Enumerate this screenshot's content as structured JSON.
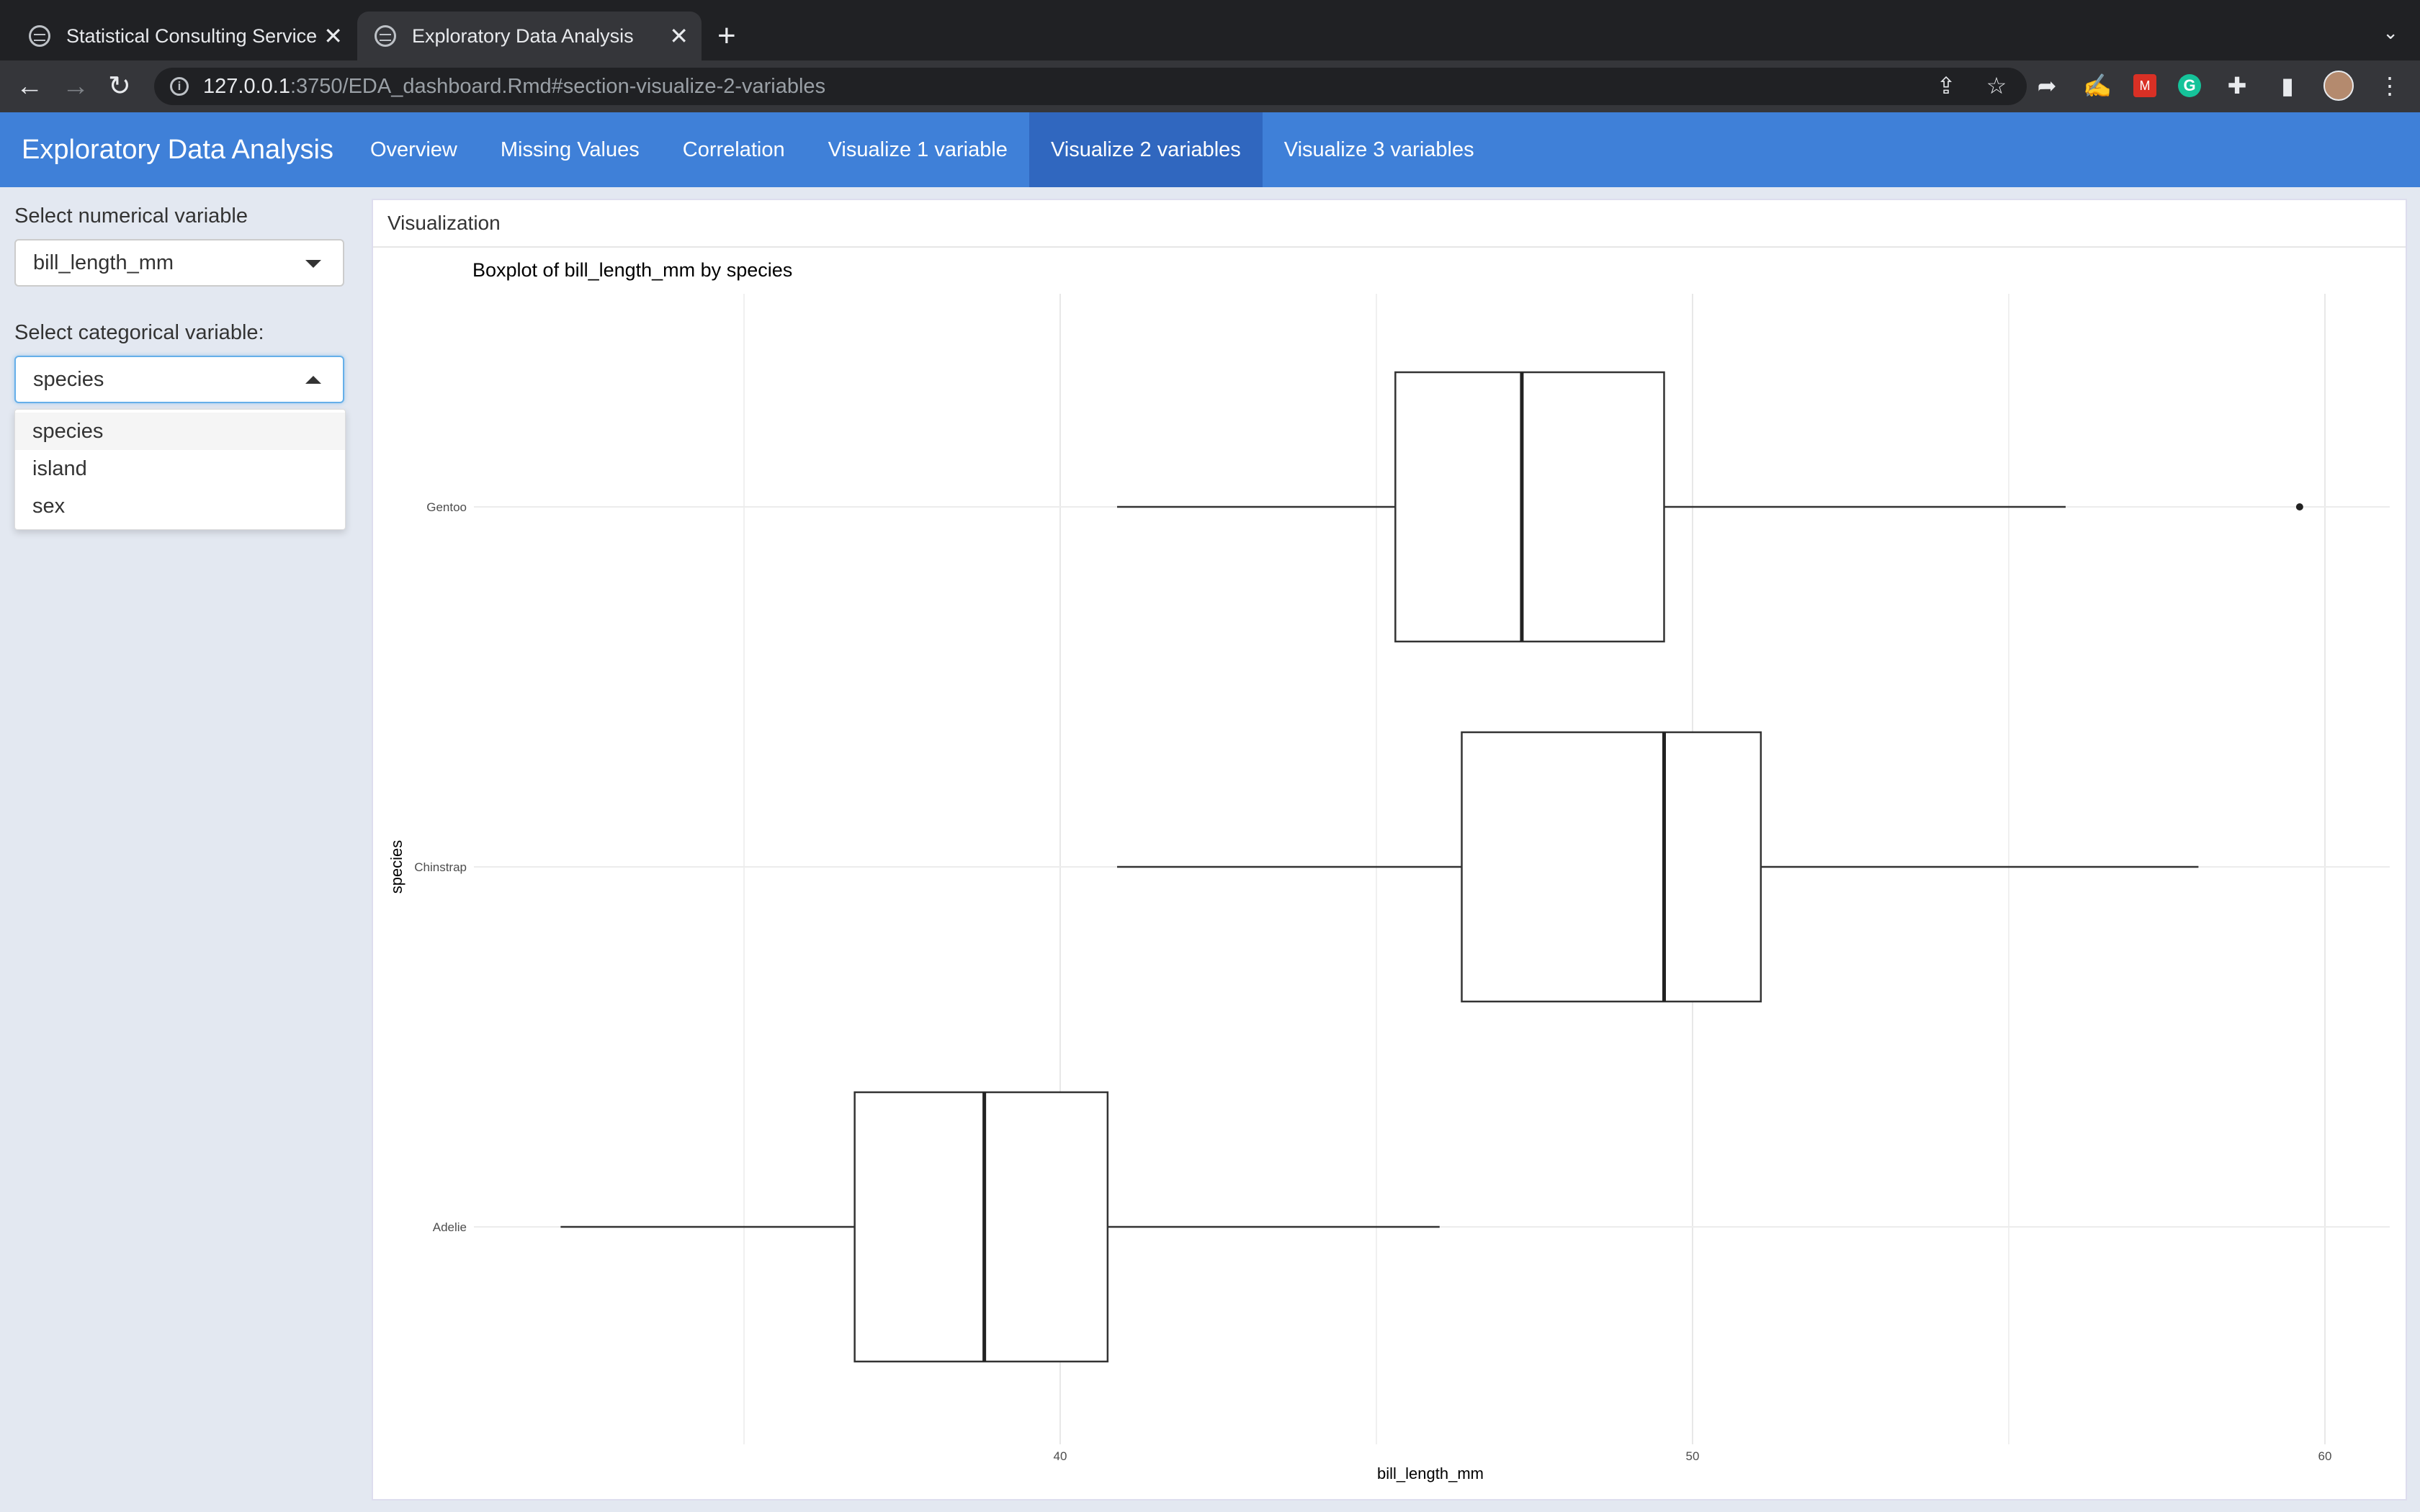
{
  "browser": {
    "tabs": [
      {
        "title": "Statistical Consulting Service",
        "active": false
      },
      {
        "title": "Exploratory Data Analysis",
        "active": true
      }
    ],
    "url_host": "127.0.0.1",
    "url_rest": ":3750/EDA_dashboard.Rmd#section-visualize-2-variables"
  },
  "app": {
    "brand": "Exploratory Data Analysis",
    "nav": [
      "Overview",
      "Missing Values",
      "Correlation",
      "Visualize 1 variable",
      "Visualize 2 variables",
      "Visualize 3 variables"
    ],
    "active_nav": "Visualize 2 variables",
    "accent_color": "#3f80d8"
  },
  "sidebar": {
    "num_label": "Select numerical variable",
    "num_value": "bill_length_mm",
    "cat_label": "Select categorical variable:",
    "cat_value": "species",
    "cat_options": [
      "species",
      "island",
      "sex"
    ]
  },
  "panel": {
    "title": "Visualization"
  },
  "chart_data": {
    "type": "boxplot",
    "orientation": "horizontal",
    "title": "Boxplot of bill_length_mm by species",
    "xlabel": "bill_length_mm",
    "ylabel": "species",
    "xlim": [
      32.1,
      60.9
    ],
    "xticks": [
      40,
      50,
      60
    ],
    "grid": true,
    "categories": [
      "Gentoo",
      "Chinstrap",
      "Adelie"
    ],
    "boxes": [
      {
        "category": "Gentoo",
        "whisker_low": 40.9,
        "q1": 45.3,
        "median": 47.3,
        "q3": 49.55,
        "whisker_high": 55.9,
        "outliers": [
          59.6
        ]
      },
      {
        "category": "Chinstrap",
        "whisker_low": 40.9,
        "q1": 46.35,
        "median": 49.55,
        "q3": 51.08,
        "whisker_high": 58.0,
        "outliers": []
      },
      {
        "category": "Adelie",
        "whisker_low": 32.1,
        "q1": 36.75,
        "median": 38.8,
        "q3": 40.75,
        "whisker_high": 46.0,
        "outliers": []
      }
    ]
  }
}
